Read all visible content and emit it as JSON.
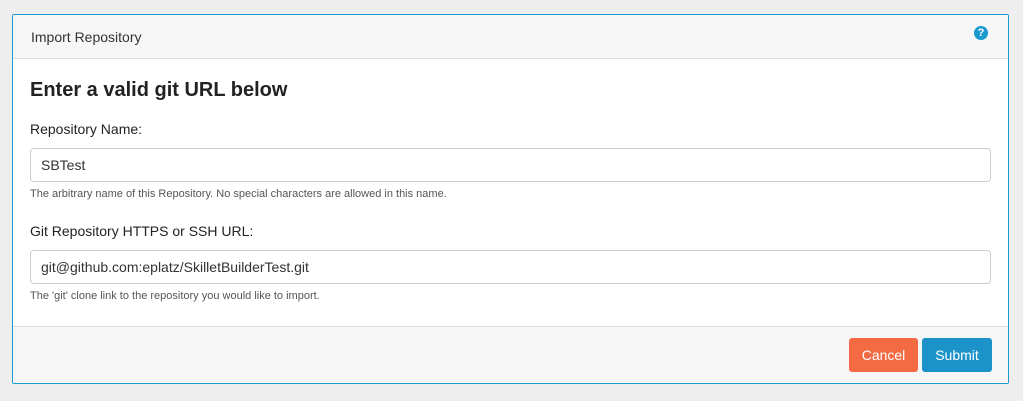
{
  "dialog": {
    "title": "Import Repository",
    "help_icon": "question-circle-icon",
    "heading": "Enter a valid git URL below",
    "fields": [
      {
        "label": "Repository Name:",
        "value": "SBTest",
        "help": "The arbitrary name of this Repository. No special characters are allowed in this name."
      },
      {
        "label": "Git Repository HTTPS or SSH URL:",
        "value": "git@github.com:eplatz/SkilletBuilderTest.git",
        "help": "The 'git' clone link to the repository you would like to import."
      }
    ],
    "buttons": {
      "cancel": "Cancel",
      "submit": "Submit"
    },
    "colors": {
      "accent": "#1b9ad0",
      "cancel": "#f36a43",
      "submit": "#1b93c9"
    }
  }
}
